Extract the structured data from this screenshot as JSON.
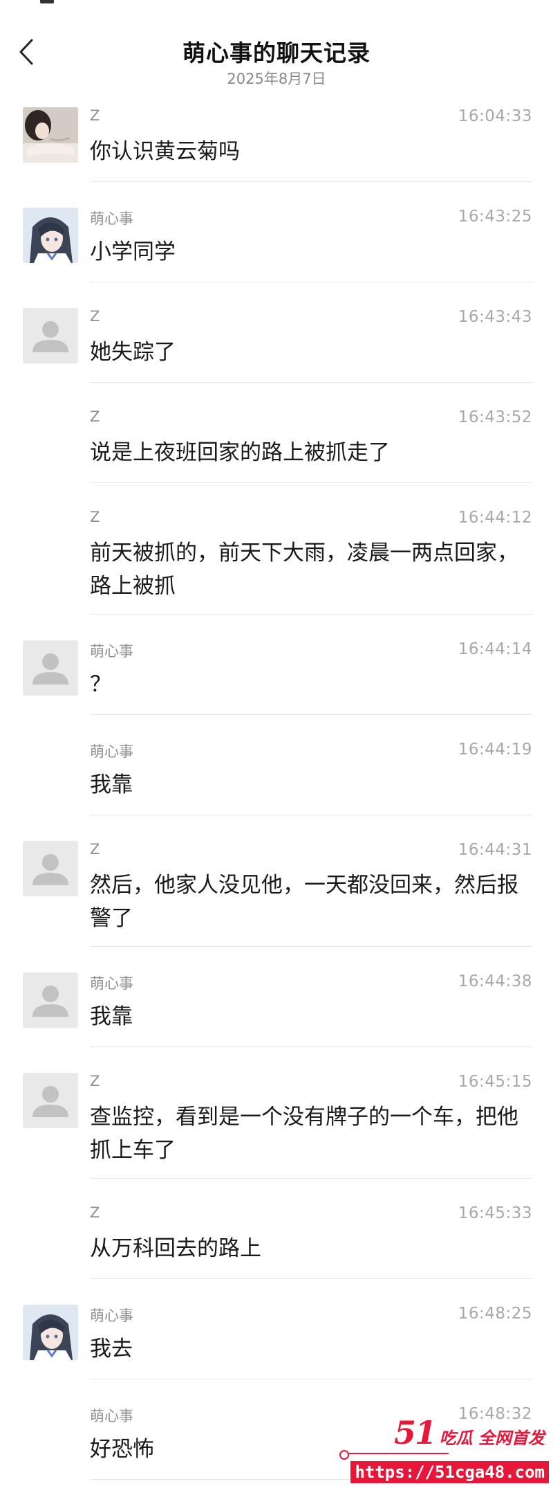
{
  "header": {
    "title": "萌心事的聊天记录",
    "date": "2025年8月7日"
  },
  "messages": [
    {
      "name": "Z",
      "time": "16:04:33",
      "text": "你认识黄云菊吗",
      "avatar": "photo-reclining"
    },
    {
      "name": "萌心事",
      "time": "16:43:25",
      "text": "小学同学",
      "avatar": "photo-anime"
    },
    {
      "name": "Z",
      "time": "16:43:43",
      "text": "她失踪了",
      "avatar": "default-person"
    },
    {
      "name": "Z",
      "time": "16:43:52",
      "text": "说是上夜班回家的路上被抓走了",
      "avatar": ""
    },
    {
      "name": "Z",
      "time": "16:44:12",
      "text": "前天被抓的，前天下大雨，凌晨一两点回家，路上被抓",
      "avatar": ""
    },
    {
      "name": "萌心事",
      "time": "16:44:14",
      "text": "？",
      "avatar": "default-person"
    },
    {
      "name": "萌心事",
      "time": "16:44:19",
      "text": "我靠",
      "avatar": ""
    },
    {
      "name": "Z",
      "time": "16:44:31",
      "text": "然后，他家人没见他，一天都没回来，然后报警了",
      "avatar": "default-person"
    },
    {
      "name": "萌心事",
      "time": "16:44:38",
      "text": "我靠",
      "avatar": "default-person"
    },
    {
      "name": "Z",
      "time": "16:45:15",
      "text": "查监控，看到是一个没有牌子的一个车，把他抓上车了",
      "avatar": "default-person"
    },
    {
      "name": "Z",
      "time": "16:45:33",
      "text": "从万科回去的路上",
      "avatar": ""
    },
    {
      "name": "萌心事",
      "time": "16:48:25",
      "text": "我去",
      "avatar": "photo-anime"
    },
    {
      "name": "萌心事",
      "time": "16:48:32",
      "text": "好恐怖",
      "avatar": ""
    }
  ],
  "watermark": {
    "number": "51",
    "tagline": "吃瓜 全网首发",
    "url": "https://51cga48.com"
  },
  "colors": {
    "watermark": "#e8173a",
    "time_text": "#a8a8a8",
    "divider": "#e6e6e6"
  }
}
